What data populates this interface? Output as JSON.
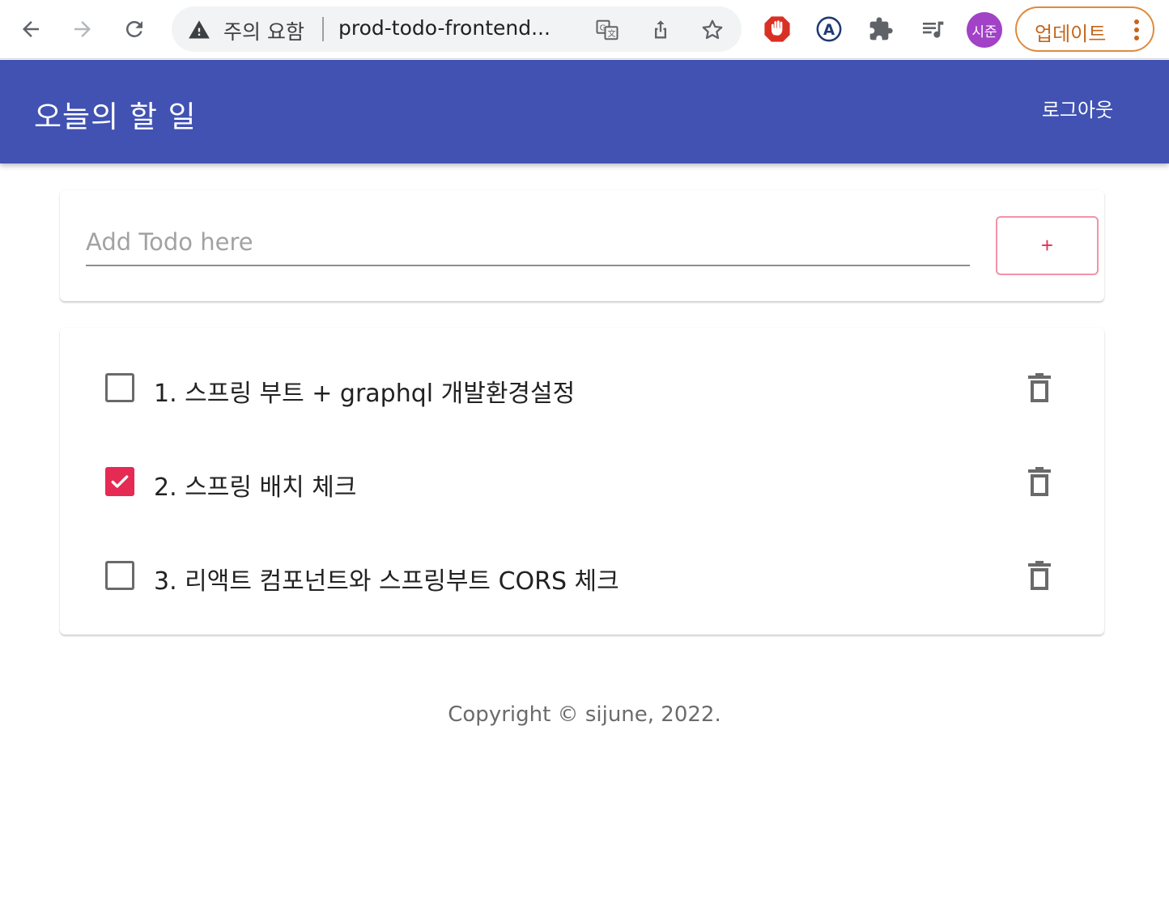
{
  "browser": {
    "security_warning": "주의 요함",
    "url": "prod-todo-frontend...",
    "profile_initials": "시준",
    "update_label": "업데이트",
    "colors": {
      "avatar": "#a142c7",
      "update_border": "#e08a3b"
    }
  },
  "app": {
    "title": "오늘의 할 일",
    "logout_label": "로그아웃",
    "colors": {
      "app_bar": "#4152b3",
      "accent": "#e52a53"
    }
  },
  "add_todo": {
    "placeholder": "Add Todo here",
    "value": "",
    "add_button_label": "+"
  },
  "todos": [
    {
      "text": "1. 스프링 부트 + graphql 개발환경설정",
      "done": false
    },
    {
      "text": "2. 스프링 배치 체크",
      "done": true
    },
    {
      "text": "3. 리액트 컴포넌트와 스프링부트 CORS 체크",
      "done": false
    }
  ],
  "footer": {
    "copyright": "Copyright © sijune, 2022."
  }
}
